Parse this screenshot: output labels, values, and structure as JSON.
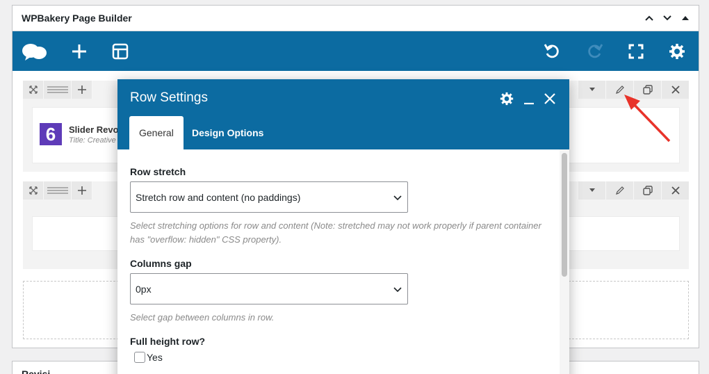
{
  "metabox": {
    "title": "WPBakery Page Builder"
  },
  "toolbar": {
    "icons": [
      "logo-icon",
      "add-element-icon",
      "templates-icon",
      "undo-icon",
      "redo-icon",
      "fullscreen-icon",
      "settings-icon"
    ]
  },
  "rows": [
    {
      "element": {
        "icon_text": "6",
        "title": "Slider Revo",
        "subtitle": "Title: Creative"
      }
    },
    {}
  ],
  "second_metabox": {
    "title": "Revisi"
  },
  "modal": {
    "title": "Row Settings",
    "tabs": [
      {
        "label": "General",
        "active": true
      },
      {
        "label": "Design Options",
        "active": false
      }
    ],
    "fields": {
      "row_stretch": {
        "label": "Row stretch",
        "value": "Stretch row and content (no paddings)",
        "help": "Select stretching options for row and content (Note: stretched may not work properly if parent container has \"overflow: hidden\" CSS property)."
      },
      "columns_gap": {
        "label": "Columns gap",
        "value": "0px",
        "help": "Select gap between columns in row."
      },
      "full_height": {
        "label": "Full height row?",
        "checkbox_label": "Yes",
        "checked": false
      }
    }
  },
  "colors": {
    "brand_blue": "#0c6ba1",
    "arrow_red": "#e8332a"
  }
}
